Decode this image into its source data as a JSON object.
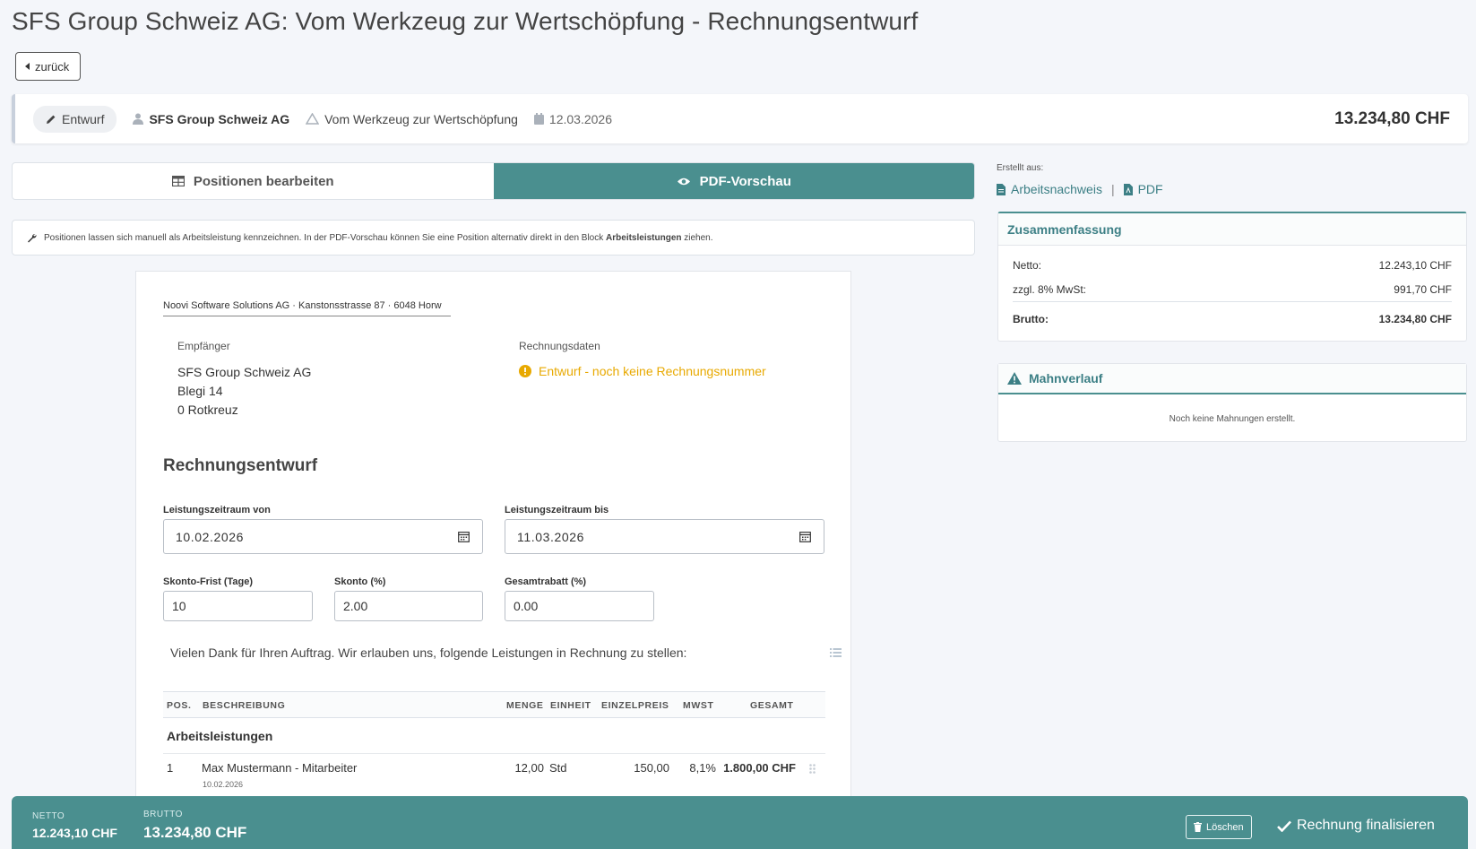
{
  "page": {
    "title": "SFS Group Schweiz AG: Vom Werkzeug zur Wertschöpfung - Rechnungsentwurf"
  },
  "nav": {
    "back_label": "zurück"
  },
  "info_bar": {
    "status": "Entwurf",
    "customer": "SFS Group Schweiz AG",
    "project": "Vom Werkzeug zur Wertschöpfung",
    "date": "12.03.2026",
    "total": "13.234,80 CHF"
  },
  "tabs": [
    {
      "label": "Positionen bearbeiten",
      "active": false
    },
    {
      "label": "PDF-Vorschau",
      "active": true
    }
  ],
  "hint": {
    "text_before": "Positionen lassen sich manuell als Arbeitsleistung kennzeichnen. In der PDF-Vorschau können Sie eine Position alternativ direkt in den Block ",
    "text_bold": "Arbeitsleistungen",
    "text_after": " ziehen."
  },
  "document": {
    "sender_line": "Noovi Software Solutions AG · Kanstonsstrasse 87 · 6048 Horw",
    "recipient_label": "Empfänger",
    "recipient": {
      "name": "SFS Group Schweiz AG",
      "street": "Blegi 14",
      "city": "0 Rotkreuz"
    },
    "invoice_data_label": "Rechnungsdaten",
    "draft_note": "Entwurf - noch keine Rechnungsnummer",
    "title": "Rechnungsentwurf",
    "fields": {
      "period_from_label": "Leistungszeitraum von",
      "period_from": "10.02.2026",
      "period_to_label": "Leistungszeitraum bis",
      "period_to": "11.03.2026",
      "skonto_days_label": "Skonto-Frist (Tage)",
      "skonto_days": "10",
      "skonto_pct_label": "Skonto (%)",
      "skonto_pct": "2.00",
      "discount_label": "Gesamtrabatt (%)",
      "discount": "0.00"
    },
    "intro": "Vielen Dank für Ihren Auftrag. Wir erlauben uns, folgende Leistungen in Rechnung zu stellen:",
    "table": {
      "headers": {
        "pos": "POS.",
        "desc": "BESCHREIBUNG",
        "qty": "MENGE",
        "unit": "EINHEIT",
        "price": "EINZELPREIS",
        "vat": "MWST",
        "total": "GESAMT"
      },
      "group": "Arbeitsleistungen",
      "rows": [
        {
          "pos": "1",
          "desc": "Max Mustermann - Mitarbeiter",
          "date": "10.02.2026",
          "qty": "12,00",
          "unit": "Std",
          "price": "150,00",
          "vat": "8,1%",
          "total": "1.800,00 CHF"
        }
      ]
    }
  },
  "sidebar": {
    "created_from_label": "Erstellt aus:",
    "link_worklog": "Arbeitsnachweis",
    "link_separator": "|",
    "link_pdf": "PDF",
    "summary": {
      "title": "Zusammenfassung",
      "net_label": "Netto:",
      "net": "12.243,10 CHF",
      "vat_label": "zzgl. 8% MwSt:",
      "vat": "991,70 CHF",
      "gross_label": "Brutto:",
      "gross": "13.234,80 CHF"
    },
    "dunning": {
      "title": "Mahnverlauf",
      "empty": "Noch keine Mahnungen erstellt."
    }
  },
  "footer": {
    "net_label": "NETTO",
    "net": "12.243,10 CHF",
    "gross_label": "BRUTTO",
    "gross": "13.234,80 CHF",
    "delete_label": "Löschen",
    "finalize_label": "Rechnung finalisieren"
  },
  "colors": {
    "accent": "#4a8f8f",
    "warning": "#e8a900"
  }
}
